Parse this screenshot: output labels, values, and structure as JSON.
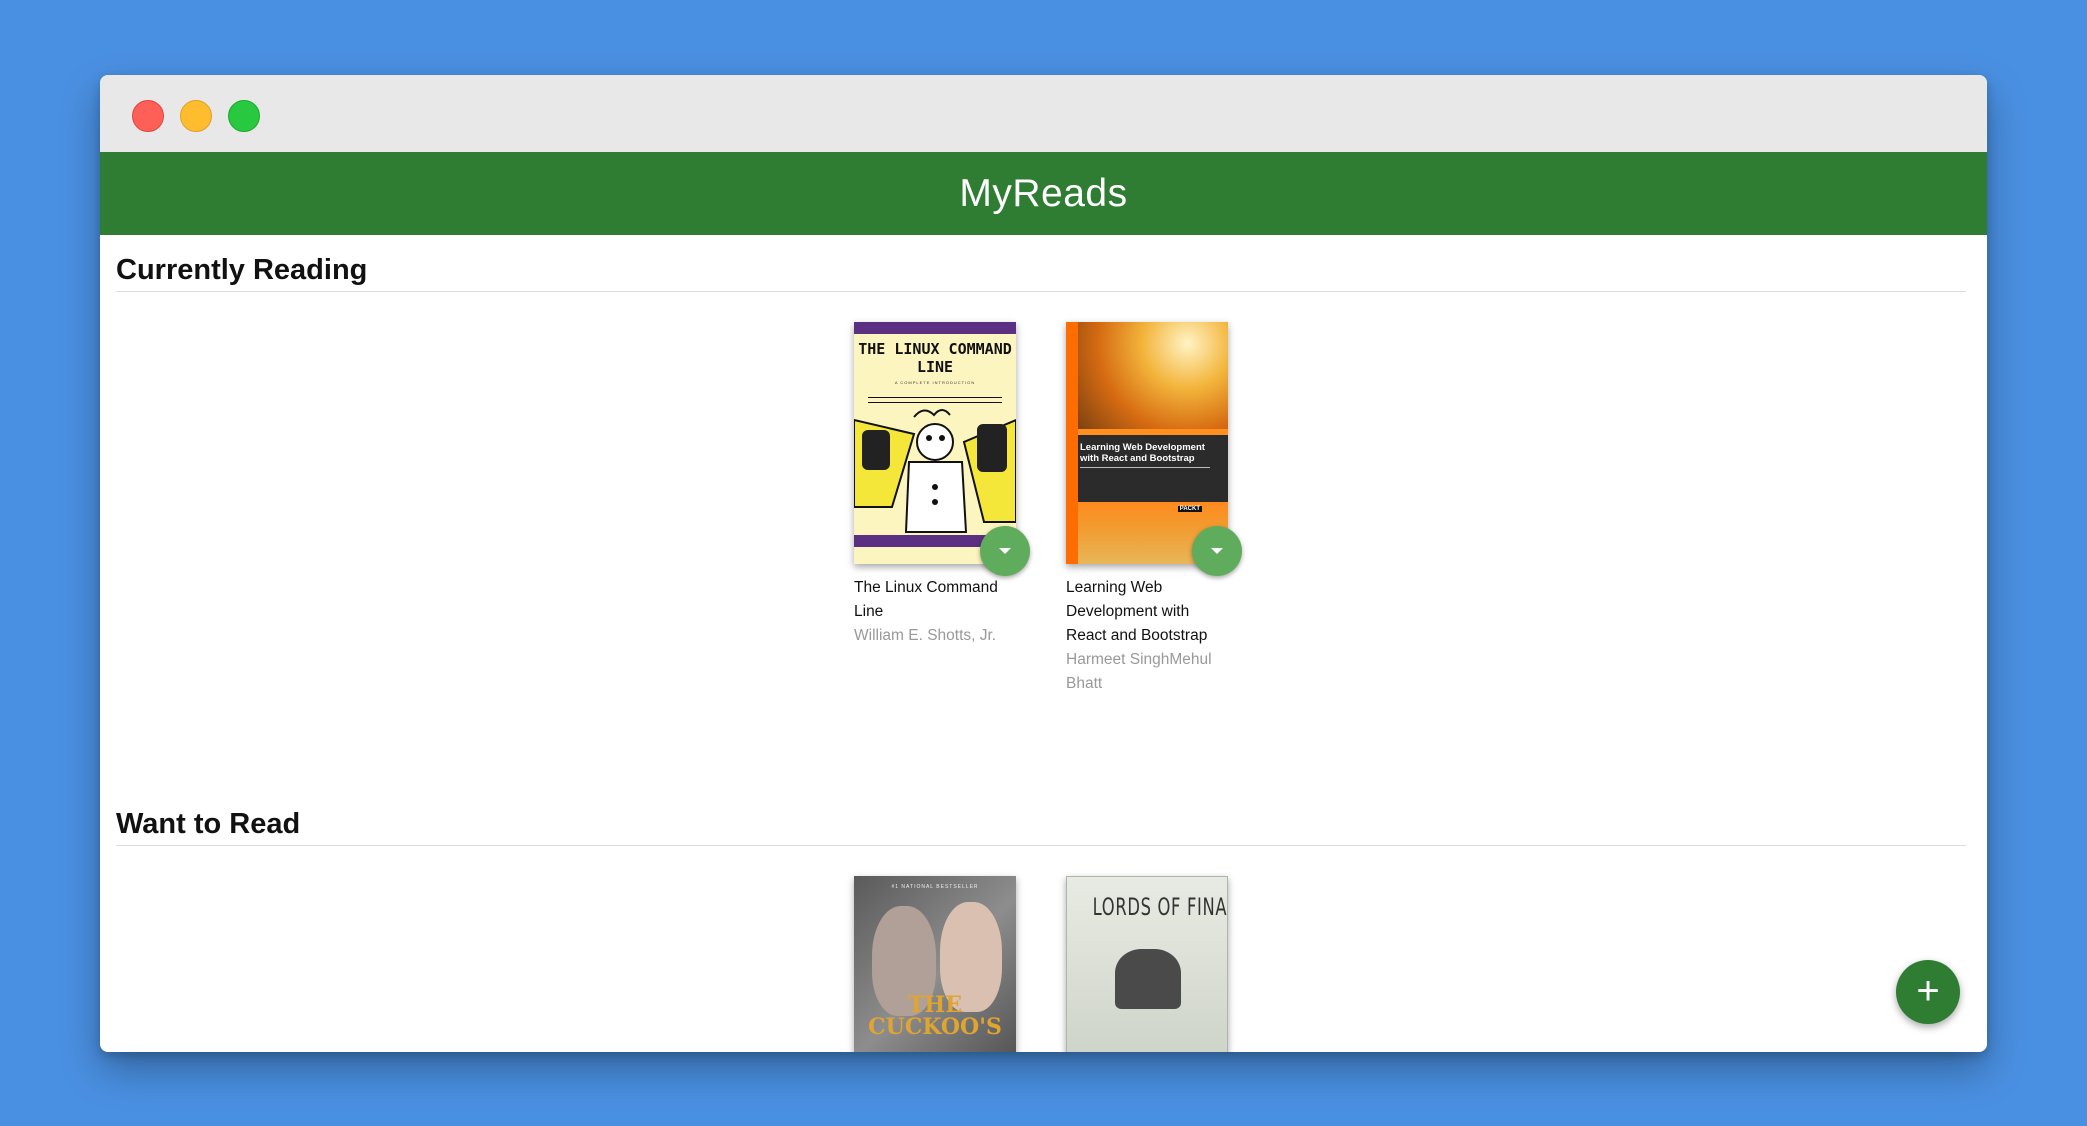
{
  "app": {
    "title": "MyReads"
  },
  "shelves": [
    {
      "title": "Currently Reading",
      "books": [
        {
          "title": "The Linux Command Line",
          "authors": "William E. Shotts, Jr.",
          "cover_title": "THE LINUX COMMAND LINE",
          "cover_subtitle": "A COMPLETE INTRODUCTION"
        },
        {
          "title": "Learning Web Development with React and Bootstrap",
          "authors": "Harmeet SinghMehul Bhatt",
          "cover_title": "Learning Web Development with React and Bootstrap",
          "cover_badge": "PACKT"
        }
      ]
    },
    {
      "title": "Want to Read",
      "books": [
        {
          "cover_caption": "#1 NATIONAL BESTSELLER",
          "cover_title": "THE CUCKOO'S"
        },
        {
          "cover_title": "LORDS OF FINANCE"
        }
      ]
    }
  ],
  "icons": {
    "shelf_changer": "triangle-down-icon",
    "add": "plus-icon"
  },
  "colors": {
    "appbar": "#2e7d32",
    "shelf_changer": "#60ac5d",
    "fab": "#2e7d32",
    "background": "#4a90e2"
  },
  "fab": {
    "label": "+"
  }
}
